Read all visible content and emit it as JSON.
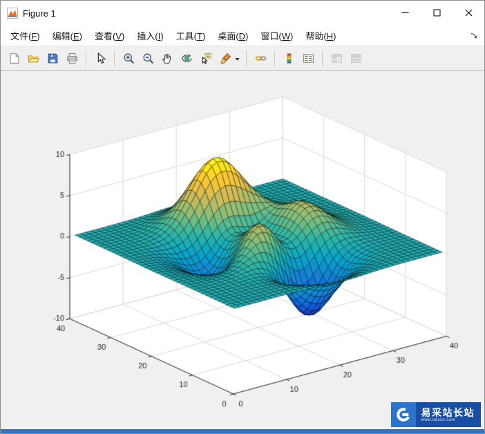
{
  "window": {
    "title": "Figure 1",
    "title_icon": "matlab-figure-icon",
    "controls": [
      {
        "name": "minimize",
        "icon": "minimize-icon"
      },
      {
        "name": "maximize",
        "icon": "maximize-icon"
      },
      {
        "name": "close",
        "icon": "close-icon"
      }
    ]
  },
  "menu_bar": {
    "items": [
      {
        "id": "file",
        "label": "文件",
        "mnemonic": "F"
      },
      {
        "id": "edit",
        "label": "编辑",
        "mnemonic": "E"
      },
      {
        "id": "view",
        "label": "查看",
        "mnemonic": "V"
      },
      {
        "id": "insert",
        "label": "插入",
        "mnemonic": "I"
      },
      {
        "id": "tools",
        "label": "工具",
        "mnemonic": "T"
      },
      {
        "id": "desktop",
        "label": "桌面",
        "mnemonic": "D"
      },
      {
        "id": "window",
        "label": "窗口",
        "mnemonic": "W"
      },
      {
        "id": "help",
        "label": "帮助",
        "mnemonic": "H"
      }
    ],
    "overflow_icon": "menu-overflow-icon"
  },
  "toolbar": {
    "items": [
      {
        "type": "button",
        "name": "new-figure",
        "icon": "new-figure-icon",
        "enabled": true
      },
      {
        "type": "button",
        "name": "open-file",
        "icon": "open-folder-icon",
        "enabled": true
      },
      {
        "type": "button",
        "name": "save-figure",
        "icon": "save-icon",
        "enabled": true
      },
      {
        "type": "button",
        "name": "print-figure",
        "icon": "print-icon",
        "enabled": true
      },
      {
        "type": "separator"
      },
      {
        "type": "button",
        "name": "edit-plot",
        "icon": "edit-plot-icon",
        "enabled": true
      },
      {
        "type": "separator"
      },
      {
        "type": "button",
        "name": "zoom-in",
        "icon": "zoom-in-icon",
        "enabled": true
      },
      {
        "type": "button",
        "name": "zoom-out",
        "icon": "zoom-out-icon",
        "enabled": true
      },
      {
        "type": "button",
        "name": "pan",
        "icon": "pan-icon",
        "enabled": true
      },
      {
        "type": "button",
        "name": "rotate-3d",
        "icon": "rotate-3d-icon",
        "enabled": true
      },
      {
        "type": "button",
        "name": "data-cursor",
        "icon": "data-cursor-icon",
        "enabled": true
      },
      {
        "type": "button",
        "name": "brush-data",
        "icon": "brush-icon",
        "enabled": true,
        "dropdown": true
      },
      {
        "type": "separator"
      },
      {
        "type": "button",
        "name": "link-plot",
        "icon": "link-plot-icon",
        "enabled": true
      },
      {
        "type": "separator"
      },
      {
        "type": "button",
        "name": "insert-colorbar",
        "icon": "colorbar-icon",
        "enabled": true
      },
      {
        "type": "button",
        "name": "insert-legend",
        "icon": "legend-icon",
        "enabled": true
      },
      {
        "type": "separator"
      },
      {
        "type": "button",
        "name": "hide-plot-tools",
        "icon": "hide-plot-tools-icon",
        "enabled": false
      },
      {
        "type": "button",
        "name": "show-plot-tools",
        "icon": "show-plot-tools-icon",
        "enabled": false
      }
    ]
  },
  "chart_data": {
    "type": "surface",
    "function": "peaks",
    "grid_n": 40,
    "domain": [
      -3,
      3
    ],
    "xlim": [
      0,
      40
    ],
    "ylim": [
      0,
      40
    ],
    "zlim": [
      -10,
      10
    ],
    "x_ticks": [
      0,
      10,
      20,
      30,
      40
    ],
    "y_ticks": [
      0,
      10,
      20,
      30,
      40
    ],
    "z_ticks": [
      -10,
      -5,
      0,
      5,
      10
    ],
    "view": {
      "azimuth": -37.5,
      "elevation": 30
    },
    "grid": true,
    "colormap": "parula",
    "colormap_stops": [
      "#352a87",
      "#0f5cdd",
      "#1481d6",
      "#06a4ca",
      "#2eb7a4",
      "#87bf77",
      "#d1bb59",
      "#fec832",
      "#f9fb0e"
    ],
    "background": "#ffffff",
    "axis_color": "#262626",
    "grid_color": "#d9d9d9",
    "edge_color": "rgba(0,0,0,0.8)"
  },
  "watermark": {
    "text": "易采站长站",
    "subtext": "www.easck.com",
    "logo_icon": "easck-logo-icon",
    "colors": {
      "logo_bg": "#2e73cb",
      "panel_bg": "#184fa5",
      "strip": "#2e73cb"
    }
  }
}
